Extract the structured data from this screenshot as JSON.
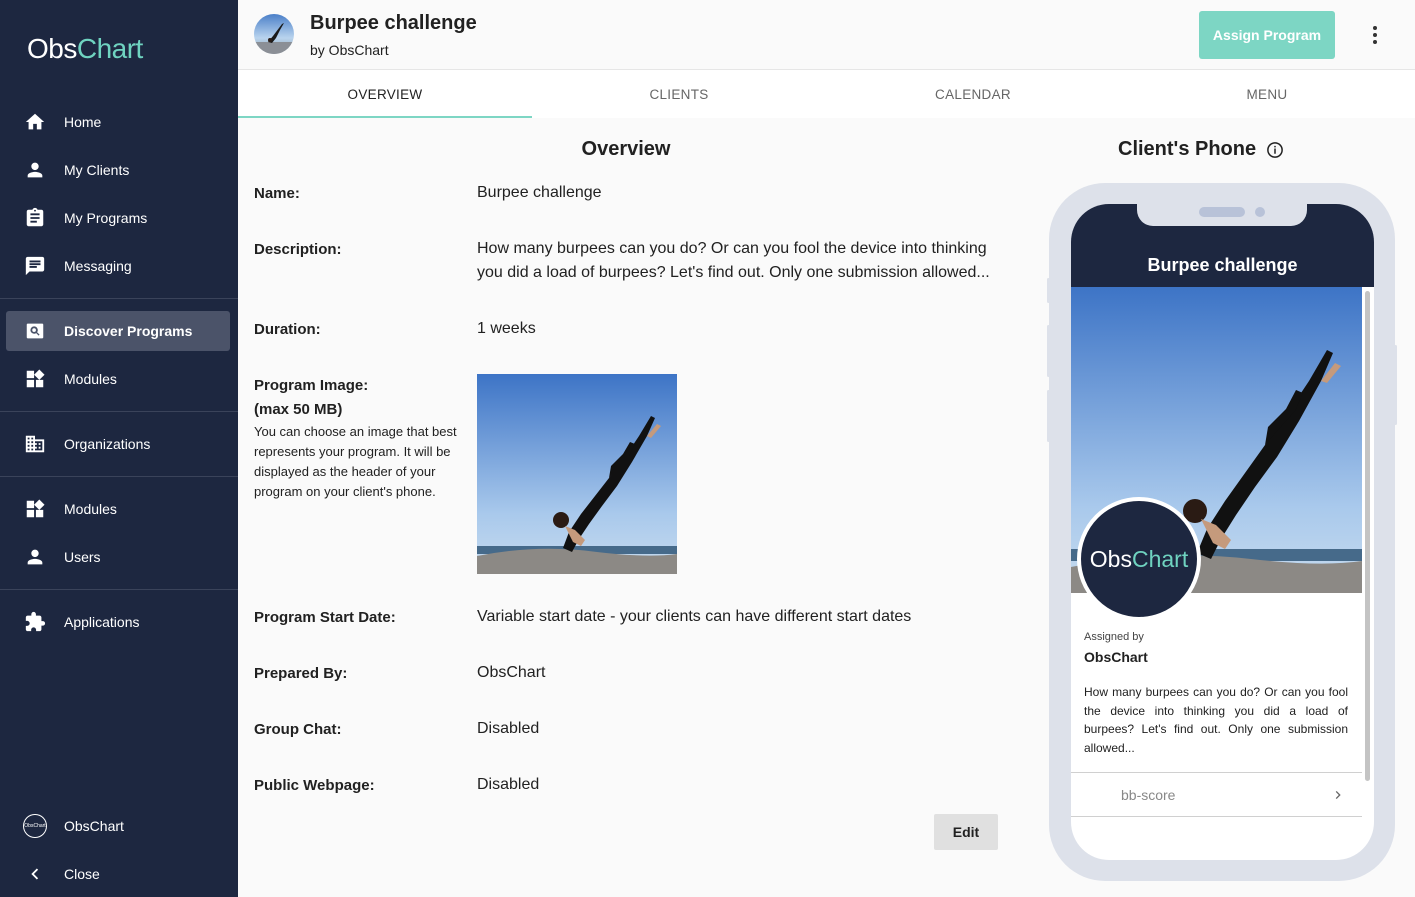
{
  "sidebar": {
    "logo_obs": "Obs",
    "logo_chart": "Chart",
    "items": [
      {
        "label": "Home",
        "icon": "home-icon"
      },
      {
        "label": "My Clients",
        "icon": "person-icon"
      },
      {
        "label": "My Programs",
        "icon": "clipboard-icon"
      },
      {
        "label": "Messaging",
        "icon": "message-icon"
      },
      {
        "label": "Discover Programs",
        "icon": "search-icon",
        "active": true
      },
      {
        "label": "Modules",
        "icon": "widgets-icon"
      },
      {
        "label": "Organizations",
        "icon": "building-icon"
      },
      {
        "label": "Modules",
        "icon": "widgets-icon"
      },
      {
        "label": "Users",
        "icon": "person-icon"
      },
      {
        "label": "Applications",
        "icon": "puzzle-icon"
      }
    ],
    "account_label": "ObsChart",
    "account_avatar_text": "ObsChart",
    "close_label": "Close"
  },
  "header": {
    "title": "Burpee challenge",
    "by": "by ObsChart",
    "assign_label": "Assign Program"
  },
  "tabs": [
    "OVERVIEW",
    "CLIENTS",
    "CALENDAR",
    "MENU"
  ],
  "overview": {
    "title": "Overview",
    "name_label": "Name:",
    "name_value": "Burpee challenge",
    "description_label": "Description:",
    "description_value": "How many burpees can you do? Or can you fool the device into thinking you did a load of burpees? Let's find out. Only one submission allowed...",
    "duration_label": "Duration:",
    "duration_value": "1 weeks",
    "image_label": "Program Image:",
    "image_max": "(max 50 MB)",
    "image_help": "You can choose an image that best represents your program. It will be displayed as the header of your program on your client's phone.",
    "start_label": "Program Start Date:",
    "start_value": "Variable start date - your clients can have different start dates",
    "prepared_label": "Prepared By:",
    "prepared_value": "ObsChart",
    "groupchat_label": "Group Chat:",
    "groupchat_value": "Disabled",
    "webpage_label": "Public Webpage:",
    "webpage_value": "Disabled",
    "edit_label": "Edit"
  },
  "phone": {
    "title": "Client's Phone",
    "program_title": "Burpee challenge",
    "logo_obs": "Obs",
    "logo_chart": "Chart",
    "assigned_by_label": "Assigned by",
    "assigner": "ObsChart",
    "description": "How many burpees can you do? Or can you fool the device into thinking you did a load of burpees? Let's find out. Only one submission allowed...",
    "module_label": "bb-score"
  },
  "colors": {
    "sidebar_bg": "#1d2740",
    "accent": "#7dd6c4",
    "active_item": "#4b5369"
  }
}
